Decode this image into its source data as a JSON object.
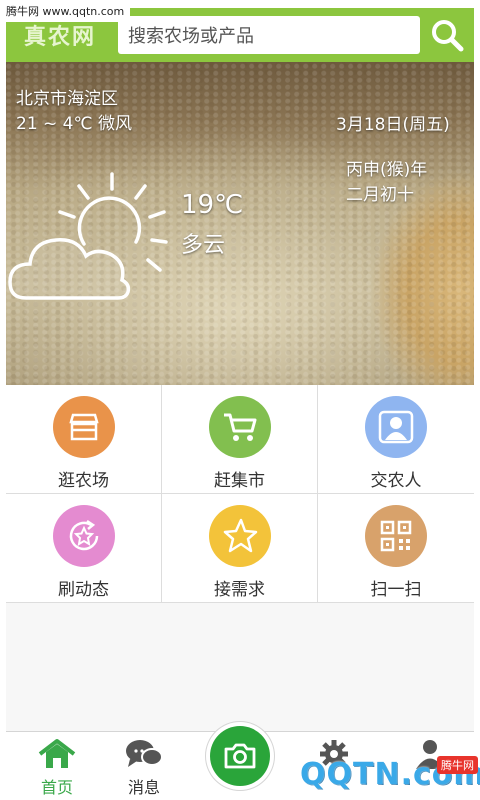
{
  "watermark": {
    "top_text": "腾牛网 www.qqtn.com",
    "bottom_logo": "QQTN.com",
    "badge": "腾牛网"
  },
  "header": {
    "logo": "真农网",
    "search_placeholder": "搜索农场或产品"
  },
  "weather": {
    "location": "北京市海淀区",
    "range": "21 ~ 4℃  微风",
    "date": "3月18日(周五)",
    "lunar_year": "丙申(猴)年",
    "lunar_day": "二月初十",
    "temp": "19℃",
    "condition": "多云"
  },
  "grid": {
    "items": [
      {
        "label": "逛农场",
        "icon": "shop-icon",
        "color": "#e9934a"
      },
      {
        "label": "赶集市",
        "icon": "cart-icon",
        "color": "#82bf4f"
      },
      {
        "label": "交农人",
        "icon": "person-icon",
        "color": "#8fb5f0"
      },
      {
        "label": "刷动态",
        "icon": "star-refresh-icon",
        "color": "#e48bd0"
      },
      {
        "label": "接需求",
        "icon": "star-icon",
        "color": "#f3c33a"
      },
      {
        "label": "扫一扫",
        "icon": "qr-icon",
        "color": "#d8a26b"
      }
    ]
  },
  "tabbar": {
    "items": [
      {
        "label": "首页",
        "icon": "home-icon",
        "color": "#3aa84a"
      },
      {
        "label": "消息",
        "icon": "message-icon",
        "color": "#555555"
      },
      {
        "label": "",
        "icon": "camera-icon",
        "color": "#2aa53a"
      },
      {
        "label": "",
        "icon": "gear-icon",
        "color": "#555555"
      },
      {
        "label": "",
        "icon": "user-icon",
        "color": "#555555"
      }
    ]
  },
  "colors": {
    "accent": "#8cc63e",
    "primary_green": "#2aa53a"
  }
}
